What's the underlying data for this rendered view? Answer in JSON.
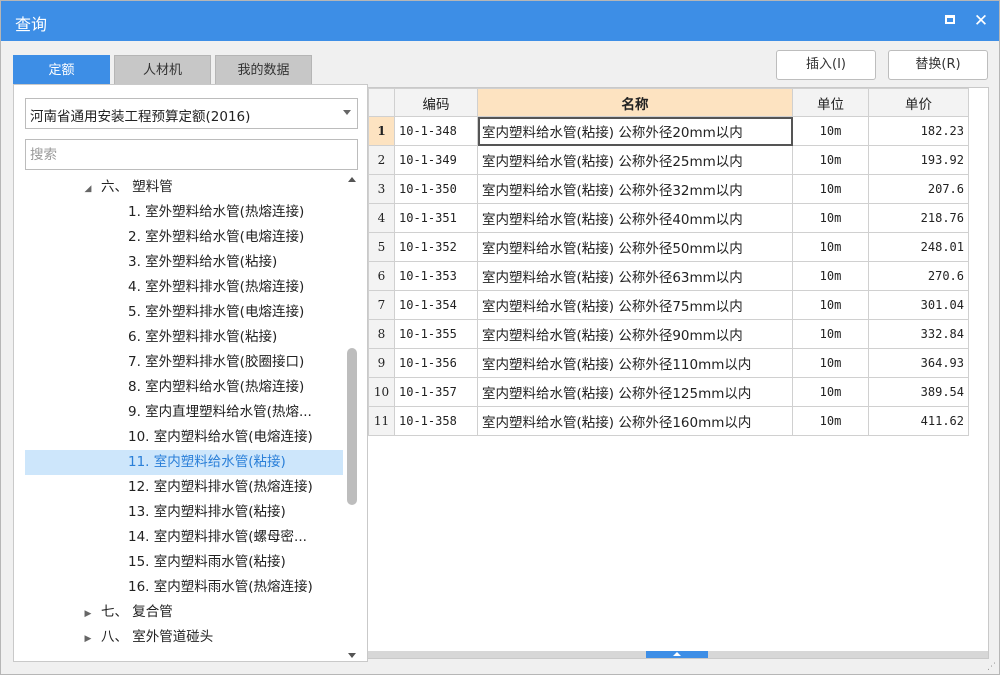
{
  "window": {
    "title": "查询"
  },
  "tabs": [
    {
      "label": "定额",
      "active": true
    },
    {
      "label": "人材机",
      "active": false
    },
    {
      "label": "我的数据",
      "active": false
    }
  ],
  "toolbar": {
    "insert_label": "插入(I)",
    "replace_label": "替换(R)"
  },
  "left": {
    "select_value": "河南省通用安装工程预算定额(2016)",
    "search_placeholder": "搜索",
    "tree": [
      {
        "caret": "◢",
        "label": "六、 塑料管",
        "indent": 1
      },
      {
        "caret": "",
        "label": "1. 室外塑料给水管(热熔连接)",
        "indent": 2
      },
      {
        "caret": "",
        "label": "2. 室外塑料给水管(电熔连接)",
        "indent": 2
      },
      {
        "caret": "",
        "label": "3. 室外塑料给水管(粘接)",
        "indent": 2
      },
      {
        "caret": "",
        "label": "4. 室外塑料排水管(热熔连接)",
        "indent": 2
      },
      {
        "caret": "",
        "label": "5. 室外塑料排水管(电熔连接)",
        "indent": 2
      },
      {
        "caret": "",
        "label": "6. 室外塑料排水管(粘接)",
        "indent": 2
      },
      {
        "caret": "",
        "label": "7. 室外塑料排水管(胶圈接口)",
        "indent": 2
      },
      {
        "caret": "",
        "label": "8. 室内塑料给水管(热熔连接)",
        "indent": 2
      },
      {
        "caret": "",
        "label": "9. 室内直埋塑料给水管(热熔...",
        "indent": 2
      },
      {
        "caret": "",
        "label": "10. 室内塑料给水管(电熔连接)",
        "indent": 2
      },
      {
        "caret": "",
        "label": "11. 室内塑料给水管(粘接)",
        "indent": 2,
        "selected": true
      },
      {
        "caret": "",
        "label": "12. 室内塑料排水管(热熔连接)",
        "indent": 2
      },
      {
        "caret": "",
        "label": "13. 室内塑料排水管(粘接)",
        "indent": 2
      },
      {
        "caret": "",
        "label": "14. 室内塑料排水管(螺母密...",
        "indent": 2
      },
      {
        "caret": "",
        "label": "15. 室内塑料雨水管(粘接)",
        "indent": 2
      },
      {
        "caret": "",
        "label": "16. 室内塑料雨水管(热熔连接)",
        "indent": 2
      },
      {
        "caret": "▶",
        "label": "七、 复合管",
        "indent": 1
      },
      {
        "caret": "▶",
        "label": "八、 室外管道碰头",
        "indent": 1
      }
    ]
  },
  "grid": {
    "columns": [
      "",
      "编码",
      "名称",
      "单位",
      "单价"
    ],
    "rows": [
      {
        "idx": "1",
        "code": "10-1-348",
        "name": "室内塑料给水管(粘接) 公称外径20mm以内",
        "unit": "10m",
        "price": "182.23"
      },
      {
        "idx": "2",
        "code": "10-1-349",
        "name": "室内塑料给水管(粘接) 公称外径25mm以内",
        "unit": "10m",
        "price": "193.92"
      },
      {
        "idx": "3",
        "code": "10-1-350",
        "name": "室内塑料给水管(粘接) 公称外径32mm以内",
        "unit": "10m",
        "price": "207.6"
      },
      {
        "idx": "4",
        "code": "10-1-351",
        "name": "室内塑料给水管(粘接) 公称外径40mm以内",
        "unit": "10m",
        "price": "218.76"
      },
      {
        "idx": "5",
        "code": "10-1-352",
        "name": "室内塑料给水管(粘接) 公称外径50mm以内",
        "unit": "10m",
        "price": "248.01"
      },
      {
        "idx": "6",
        "code": "10-1-353",
        "name": "室内塑料给水管(粘接) 公称外径63mm以内",
        "unit": "10m",
        "price": "270.6"
      },
      {
        "idx": "7",
        "code": "10-1-354",
        "name": "室内塑料给水管(粘接) 公称外径75mm以内",
        "unit": "10m",
        "price": "301.04"
      },
      {
        "idx": "8",
        "code": "10-1-355",
        "name": "室内塑料给水管(粘接) 公称外径90mm以内",
        "unit": "10m",
        "price": "332.84"
      },
      {
        "idx": "9",
        "code": "10-1-356",
        "name": "室内塑料给水管(粘接) 公称外径110mm以内",
        "unit": "10m",
        "price": "364.93"
      },
      {
        "idx": "10",
        "code": "10-1-357",
        "name": "室内塑料给水管(粘接) 公称外径125mm以内",
        "unit": "10m",
        "price": "389.54"
      },
      {
        "idx": "11",
        "code": "10-1-358",
        "name": "室内塑料给水管(粘接) 公称外径160mm以内",
        "unit": "10m",
        "price": "411.62"
      }
    ]
  },
  "colors": {
    "accent": "#3d8ee6",
    "selected_bg": "#cde6fb",
    "header_highlight": "#fde3c1"
  }
}
